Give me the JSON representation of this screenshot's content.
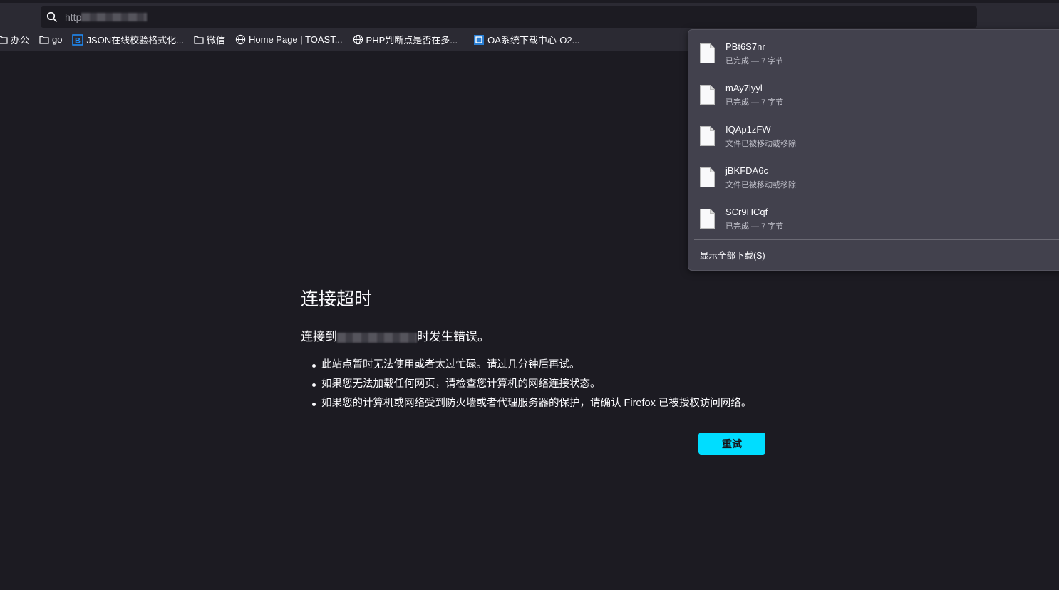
{
  "url_bar": {
    "text": "http"
  },
  "bookmarks": [
    {
      "label": "办公",
      "icon": "folder-icon"
    },
    {
      "label": "go",
      "icon": "folder-icon"
    },
    {
      "label": "JSON在线校验格式化...",
      "icon": "bejson-icon"
    },
    {
      "label": "微信",
      "icon": "folder-icon"
    },
    {
      "label": "Home Page | TOAST...",
      "icon": "globe-icon"
    },
    {
      "label": "PHP判断点是否在多...",
      "icon": "globe-icon"
    },
    {
      "label": "OA系统下载中心-O2...",
      "icon": "oa-icon"
    }
  ],
  "error": {
    "title": "连接超时",
    "desc_prefix": "连接到",
    "desc_suffix": "时发生错误。",
    "items": [
      "此站点暂时无法使用或者太过忙碌。请过几分钟后再试。",
      "如果您无法加载任何网页，请检查您计算机的网络连接状态。",
      "如果您的计算机或网络受到防火墙或者代理服务器的保护，请确认 Firefox 已被授权访问网络。"
    ],
    "retry_label": "重试"
  },
  "downloads": {
    "items": [
      {
        "name": "PBt6S7nr",
        "status": "已完成 — 7 字节"
      },
      {
        "name": "mAy7lyyl",
        "status": "已完成 — 7 字节"
      },
      {
        "name": "IQAp1zFW",
        "status": "文件已被移动或移除"
      },
      {
        "name": "jBKFDA6c",
        "status": "文件已被移动或移除"
      },
      {
        "name": "SCr9HCqf",
        "status": "已完成 — 7 字节"
      }
    ],
    "show_all": "显示全部下载(S)"
  },
  "colors": {
    "accent": "#00ddff",
    "panel": "#42414d",
    "background": "#1c1b22"
  }
}
